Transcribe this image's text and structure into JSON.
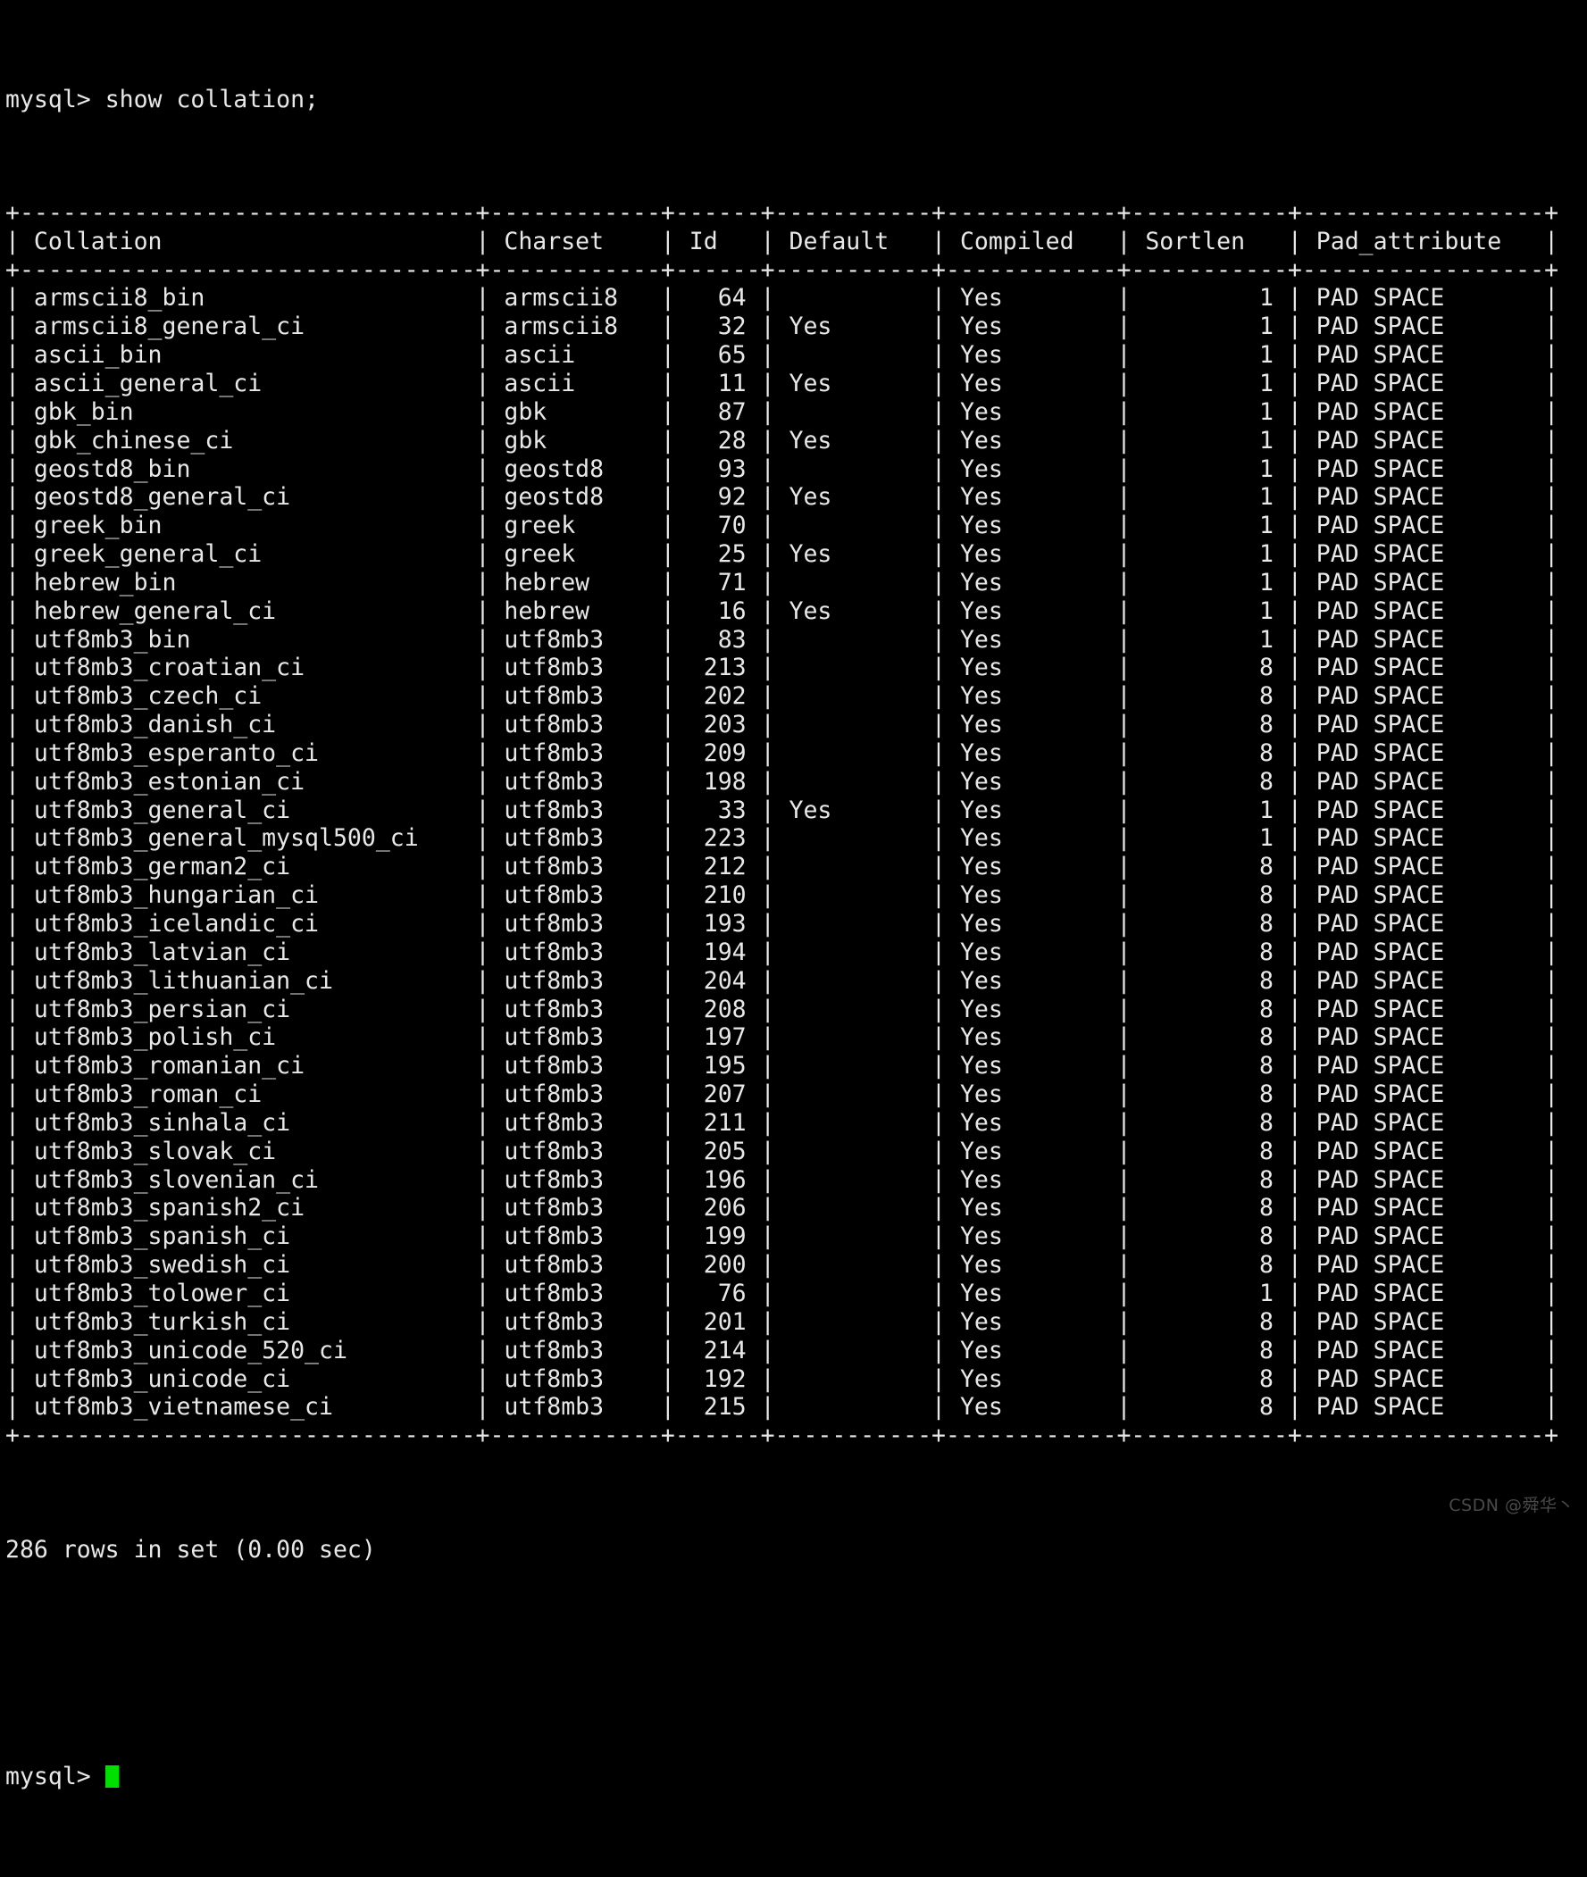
{
  "terminal": {
    "prompt": "mysql>",
    "command": " show collation;",
    "result_line": "286 rows in set (0.00 sec)",
    "final_prompt": "mysql>",
    "cursor": "block-cursor",
    "watermark": "CSDN @舜华丶",
    "colors": {
      "background": "#000000",
      "foreground": "#e8e8e8",
      "cursor": "#00e000",
      "watermark": "#4a4a4a"
    }
  },
  "table": {
    "columns": [
      {
        "name": "Collation",
        "width": 30,
        "align": "left"
      },
      {
        "name": "Charset",
        "width": 10,
        "align": "left"
      },
      {
        "name": "Id",
        "width": 4,
        "align": "right"
      },
      {
        "name": "Default",
        "width": 9,
        "align": "left"
      },
      {
        "name": "Compiled",
        "width": 10,
        "align": "left"
      },
      {
        "name": "Sortlen",
        "width": 9,
        "align": "right"
      },
      {
        "name": "Pad_attribute",
        "width": 15,
        "align": "left"
      }
    ],
    "rows": [
      [
        "armscii8_bin",
        "armscii8",
        "64",
        "",
        "Yes",
        "1",
        "PAD SPACE"
      ],
      [
        "armscii8_general_ci",
        "armscii8",
        "32",
        "Yes",
        "Yes",
        "1",
        "PAD SPACE"
      ],
      [
        "ascii_bin",
        "ascii",
        "65",
        "",
        "Yes",
        "1",
        "PAD SPACE"
      ],
      [
        "ascii_general_ci",
        "ascii",
        "11",
        "Yes",
        "Yes",
        "1",
        "PAD SPACE"
      ],
      [
        "gbk_bin",
        "gbk",
        "87",
        "",
        "Yes",
        "1",
        "PAD SPACE"
      ],
      [
        "gbk_chinese_ci",
        "gbk",
        "28",
        "Yes",
        "Yes",
        "1",
        "PAD SPACE"
      ],
      [
        "geostd8_bin",
        "geostd8",
        "93",
        "",
        "Yes",
        "1",
        "PAD SPACE"
      ],
      [
        "geostd8_general_ci",
        "geostd8",
        "92",
        "Yes",
        "Yes",
        "1",
        "PAD SPACE"
      ],
      [
        "greek_bin",
        "greek",
        "70",
        "",
        "Yes",
        "1",
        "PAD SPACE"
      ],
      [
        "greek_general_ci",
        "greek",
        "25",
        "Yes",
        "Yes",
        "1",
        "PAD SPACE"
      ],
      [
        "hebrew_bin",
        "hebrew",
        "71",
        "",
        "Yes",
        "1",
        "PAD SPACE"
      ],
      [
        "hebrew_general_ci",
        "hebrew",
        "16",
        "Yes",
        "Yes",
        "1",
        "PAD SPACE"
      ],
      [
        "utf8mb3_bin",
        "utf8mb3",
        "83",
        "",
        "Yes",
        "1",
        "PAD SPACE"
      ],
      [
        "utf8mb3_croatian_ci",
        "utf8mb3",
        "213",
        "",
        "Yes",
        "8",
        "PAD SPACE"
      ],
      [
        "utf8mb3_czech_ci",
        "utf8mb3",
        "202",
        "",
        "Yes",
        "8",
        "PAD SPACE"
      ],
      [
        "utf8mb3_danish_ci",
        "utf8mb3",
        "203",
        "",
        "Yes",
        "8",
        "PAD SPACE"
      ],
      [
        "utf8mb3_esperanto_ci",
        "utf8mb3",
        "209",
        "",
        "Yes",
        "8",
        "PAD SPACE"
      ],
      [
        "utf8mb3_estonian_ci",
        "utf8mb3",
        "198",
        "",
        "Yes",
        "8",
        "PAD SPACE"
      ],
      [
        "utf8mb3_general_ci",
        "utf8mb3",
        "33",
        "Yes",
        "Yes",
        "1",
        "PAD SPACE"
      ],
      [
        "utf8mb3_general_mysql500_ci",
        "utf8mb3",
        "223",
        "",
        "Yes",
        "1",
        "PAD SPACE"
      ],
      [
        "utf8mb3_german2_ci",
        "utf8mb3",
        "212",
        "",
        "Yes",
        "8",
        "PAD SPACE"
      ],
      [
        "utf8mb3_hungarian_ci",
        "utf8mb3",
        "210",
        "",
        "Yes",
        "8",
        "PAD SPACE"
      ],
      [
        "utf8mb3_icelandic_ci",
        "utf8mb3",
        "193",
        "",
        "Yes",
        "8",
        "PAD SPACE"
      ],
      [
        "utf8mb3_latvian_ci",
        "utf8mb3",
        "194",
        "",
        "Yes",
        "8",
        "PAD SPACE"
      ],
      [
        "utf8mb3_lithuanian_ci",
        "utf8mb3",
        "204",
        "",
        "Yes",
        "8",
        "PAD SPACE"
      ],
      [
        "utf8mb3_persian_ci",
        "utf8mb3",
        "208",
        "",
        "Yes",
        "8",
        "PAD SPACE"
      ],
      [
        "utf8mb3_polish_ci",
        "utf8mb3",
        "197",
        "",
        "Yes",
        "8",
        "PAD SPACE"
      ],
      [
        "utf8mb3_romanian_ci",
        "utf8mb3",
        "195",
        "",
        "Yes",
        "8",
        "PAD SPACE"
      ],
      [
        "utf8mb3_roman_ci",
        "utf8mb3",
        "207",
        "",
        "Yes",
        "8",
        "PAD SPACE"
      ],
      [
        "utf8mb3_sinhala_ci",
        "utf8mb3",
        "211",
        "",
        "Yes",
        "8",
        "PAD SPACE"
      ],
      [
        "utf8mb3_slovak_ci",
        "utf8mb3",
        "205",
        "",
        "Yes",
        "8",
        "PAD SPACE"
      ],
      [
        "utf8mb3_slovenian_ci",
        "utf8mb3",
        "196",
        "",
        "Yes",
        "8",
        "PAD SPACE"
      ],
      [
        "utf8mb3_spanish2_ci",
        "utf8mb3",
        "206",
        "",
        "Yes",
        "8",
        "PAD SPACE"
      ],
      [
        "utf8mb3_spanish_ci",
        "utf8mb3",
        "199",
        "",
        "Yes",
        "8",
        "PAD SPACE"
      ],
      [
        "utf8mb3_swedish_ci",
        "utf8mb3",
        "200",
        "",
        "Yes",
        "8",
        "PAD SPACE"
      ],
      [
        "utf8mb3_tolower_ci",
        "utf8mb3",
        "76",
        "",
        "Yes",
        "1",
        "PAD SPACE"
      ],
      [
        "utf8mb3_turkish_ci",
        "utf8mb3",
        "201",
        "",
        "Yes",
        "8",
        "PAD SPACE"
      ],
      [
        "utf8mb3_unicode_520_ci",
        "utf8mb3",
        "214",
        "",
        "Yes",
        "8",
        "PAD SPACE"
      ],
      [
        "utf8mb3_unicode_ci",
        "utf8mb3",
        "192",
        "",
        "Yes",
        "8",
        "PAD SPACE"
      ],
      [
        "utf8mb3_vietnamese_ci",
        "utf8mb3",
        "215",
        "",
        "Yes",
        "8",
        "PAD SPACE"
      ]
    ]
  }
}
